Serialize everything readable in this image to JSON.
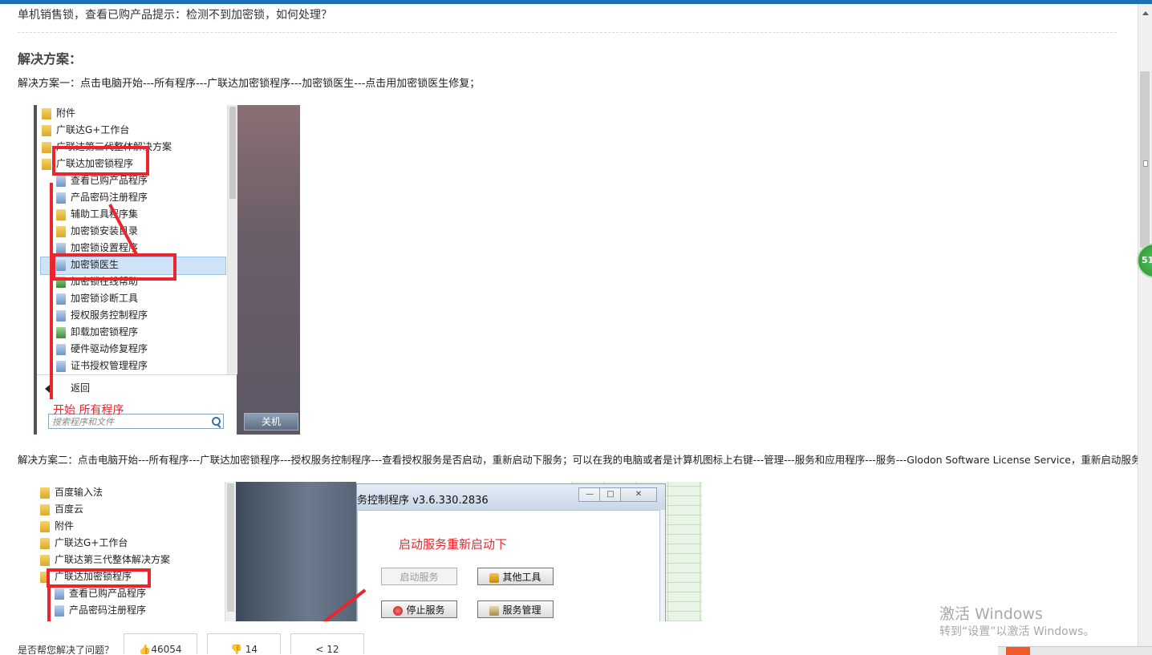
{
  "question": "单机销售锁，查看已购产品提示：检测不到加密锁，如何处理？",
  "solution_heading": "解决方案：",
  "solution1": "解决方案一：点击电脑开始---所有程序---广联达加密锁程序---加密锁医生---点击用加密锁医生修复；",
  "solution2": "解决方案二：点击电脑开始---所有程序---广联达加密锁程序---授权服务控制程序---查看授权服务是否启动，重新启动下服务；可以在我的电脑或者是计算机图标上右键---管理---服务和应用程序---服务---Glodon Software License Service，重新启动服务；",
  "shot1": {
    "items": [
      {
        "label": "附件",
        "icon": "folder-icon"
      },
      {
        "label": "广联达G+工作台",
        "icon": "folder-icon"
      },
      {
        "label": "广联达第三代整体解决方案",
        "icon": "folder-icon"
      },
      {
        "label": "广联达加密锁程序",
        "icon": "folder-icon"
      },
      {
        "label": "查看已购产品程序",
        "icon": "app-icon"
      },
      {
        "label": "产品密码注册程序",
        "icon": "app-icon"
      },
      {
        "label": "辅助工具程序集",
        "icon": "folder-icon"
      },
      {
        "label": "加密锁安装目录",
        "icon": "folder-icon"
      },
      {
        "label": "加密锁设置程序",
        "icon": "app-icon"
      },
      {
        "label": "加密锁医生",
        "icon": "app-icon"
      },
      {
        "label": "加密锁在线帮助",
        "icon": "tool-icon"
      },
      {
        "label": "加密锁诊断工具",
        "icon": "app-icon"
      },
      {
        "label": "授权服务控制程序",
        "icon": "app-icon"
      },
      {
        "label": "卸载加密锁程序",
        "icon": "tool-icon"
      },
      {
        "label": "硬件驱动修复程序",
        "icon": "app-icon"
      },
      {
        "label": "证书授权管理程序",
        "icon": "app-icon"
      }
    ],
    "back": "返回",
    "search_placeholder": "搜索程序和文件",
    "shutdown": "关机",
    "annotation": "开始  所有程序"
  },
  "shot2": {
    "items": [
      {
        "label": "百度输入法",
        "icon": "folder-icon"
      },
      {
        "label": "百度云",
        "icon": "folder-icon"
      },
      {
        "label": "附件",
        "icon": "folder-icon"
      },
      {
        "label": "广联达G+工作台",
        "icon": "folder-icon"
      },
      {
        "label": "广联达第三代整体解决方案",
        "icon": "folder-icon"
      },
      {
        "label": "广联达加密锁程序",
        "icon": "folder-icon"
      },
      {
        "label": "查看已购产品程序",
        "icon": "app-icon"
      },
      {
        "label": "产品密码注册程序",
        "icon": "app-icon"
      }
    ],
    "dialog_title": "务控制程序 v3.6.330.2836",
    "note": "启动服务重新启动下",
    "btn_start": "启动服务",
    "btn_other": "其他工具",
    "btn_stop": "停止服务",
    "btn_manage": "服务管理"
  },
  "footer": {
    "question": "是否帮您解决了问题？",
    "like_count": "46054",
    "dislike_count": "14",
    "share_count": "12"
  },
  "badge": "51",
  "watermark": {
    "line1": "激活 Windows",
    "line2": "转到“设置”以激活 Windows。"
  }
}
